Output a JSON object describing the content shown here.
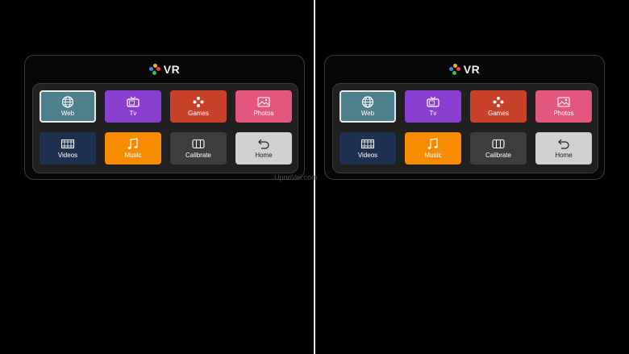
{
  "brand": {
    "title": "VR"
  },
  "colors": {
    "logo": [
      "#2f8de4",
      "#f0b41c",
      "#e8453c",
      "#30c06a"
    ],
    "web": "#4d7f8c",
    "tv": "#8a3fd0",
    "games": "#c8412a",
    "photos": "#e3567e",
    "videos": "#1e3050",
    "music": "#f78c00",
    "calibrate": "#3d3d3d",
    "home": "#d0d0d0"
  },
  "tiles": [
    {
      "label": "Web",
      "icon": "globe-icon",
      "selected": true
    },
    {
      "label": "Tv",
      "icon": "tv-icon"
    },
    {
      "label": "Games",
      "icon": "gamepad-icon"
    },
    {
      "label": "Photos",
      "icon": "image-icon"
    },
    {
      "label": "Videos",
      "icon": "film-icon"
    },
    {
      "label": "Music",
      "icon": "music-note-icon"
    },
    {
      "label": "Calibrate",
      "icon": "calibrate-icon"
    },
    {
      "label": "Home",
      "icon": "back-arrow-icon"
    }
  ],
  "watermark": "UpnoVel.com"
}
